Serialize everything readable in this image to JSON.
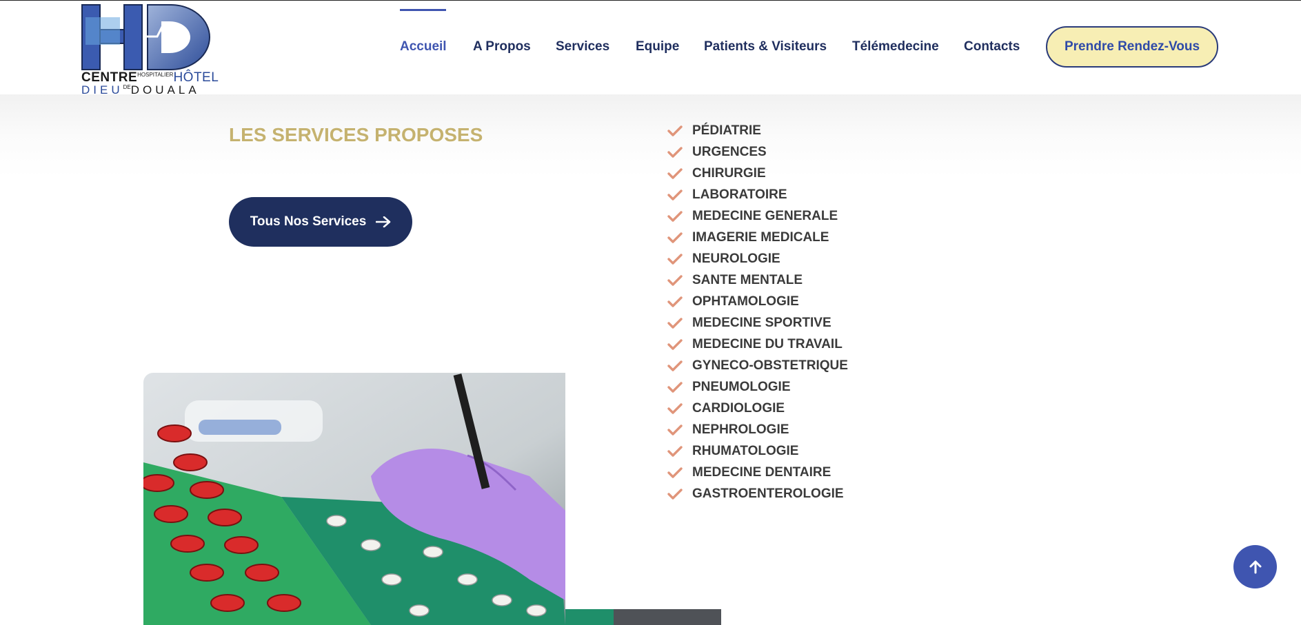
{
  "logo": {
    "word_centre": "CENTRE",
    "word_hospitalier": "HOSPITALIER",
    "word_hotel": "HÔTEL",
    "word_dieu": "DIEU",
    "word_de": "DE",
    "word_douala": "DOUALA"
  },
  "nav": {
    "items": [
      {
        "label": "Accueil",
        "active": true
      },
      {
        "label": "A Propos"
      },
      {
        "label": "Services"
      },
      {
        "label": "Equipe"
      },
      {
        "label": "Patients & Visiteurs"
      },
      {
        "label": "Télémedecine"
      },
      {
        "label": "Contacts"
      }
    ],
    "cta_label": "Prendre Rendez-Vous"
  },
  "main": {
    "section_title": "LES SERVICES PROPOSES",
    "all_services_button": "Tous Nos Services",
    "services": [
      "PÉDIATRIE",
      "URGENCES",
      "CHIRURGIE",
      "LABORATOIRE",
      "MEDECINE GENERALE",
      "IMAGERIE MEDICALE",
      "NEUROLOGIE",
      "SANTE MENTALE",
      "OPHTAMOLOGIE",
      "MEDECINE SPORTIVE",
      "MEDECINE DU TRAVAIL",
      "GYNECO-OBSTETRIQUE",
      "PNEUMOLOGIE",
      "CARDIOLOGIE",
      "NEPHROLOGIE",
      "RHUMATOLOGIE",
      "MEDECINE DENTAIRE",
      "GASTROENTEROLOGIE"
    ]
  },
  "icons": {
    "check": "check-icon",
    "arrow": "arrow-right-icon",
    "scroll_top": "arrow-up-icon"
  },
  "colors": {
    "primary_navy": "#1f2e5e",
    "accent_blue": "#3f55b0",
    "gold": "#c5b26f",
    "cta_bg": "#f7eeb4",
    "check": "#e0957a"
  }
}
